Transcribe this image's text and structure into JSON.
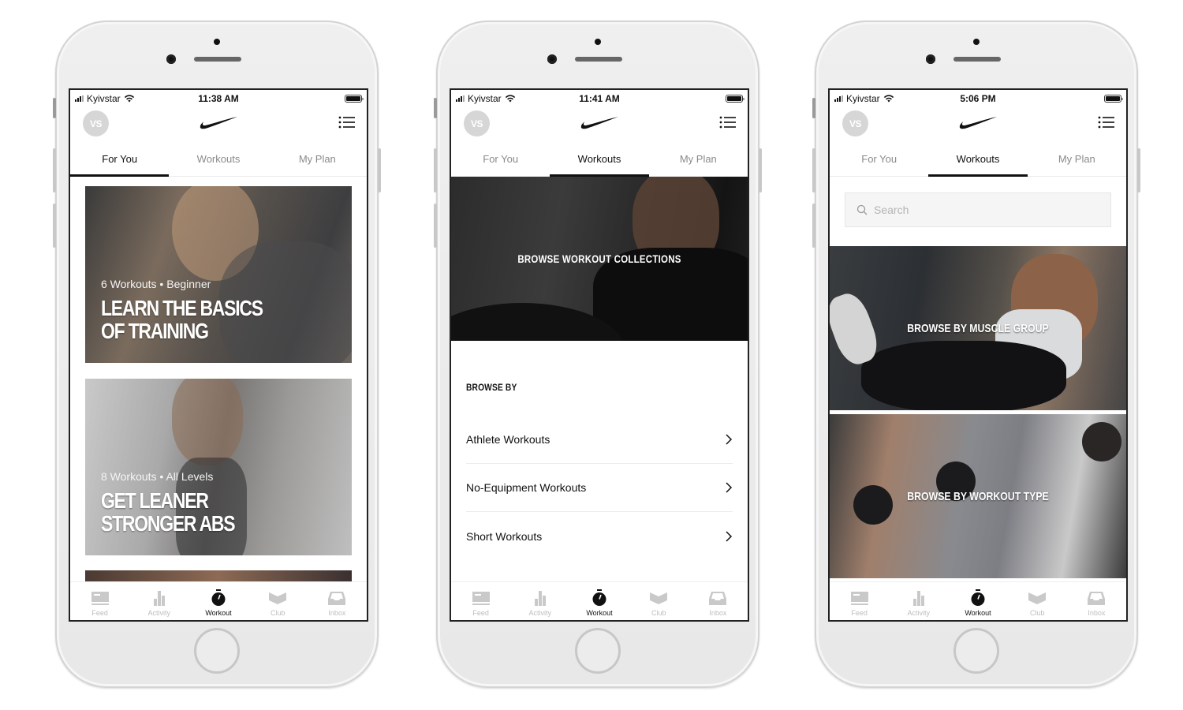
{
  "phones": [
    {
      "status": {
        "carrier": "Kyivstar",
        "time": "11:38 AM"
      },
      "header": {
        "avatar_initials": "VS",
        "logo": "nike-swoosh-icon",
        "menu_icon": "list-menu-icon"
      },
      "tabs": [
        {
          "label": "For You",
          "active": true
        },
        {
          "label": "Workouts",
          "active": false
        },
        {
          "label": "My Plan",
          "active": false
        }
      ],
      "cards": [
        {
          "meta": "6 Workouts • Beginner",
          "title_line1": "LEARN THE BASICS",
          "title_line2": "OF TRAINING"
        },
        {
          "meta": "8 Workouts • All Levels",
          "title_line1": "GET LEANER",
          "title_line2": "STRONGER ABS"
        }
      ],
      "tabbar": [
        {
          "label": "Feed",
          "icon": "feed-icon"
        },
        {
          "label": "Activity",
          "icon": "activity-icon"
        },
        {
          "label": "Workout",
          "icon": "stopwatch-icon",
          "active": true
        },
        {
          "label": "Club",
          "icon": "club-icon"
        },
        {
          "label": "Inbox",
          "icon": "inbox-icon"
        }
      ]
    },
    {
      "status": {
        "carrier": "Kyivstar",
        "time": "11:41 AM"
      },
      "header": {
        "avatar_initials": "VS",
        "logo": "nike-swoosh-icon",
        "menu_icon": "list-menu-icon"
      },
      "tabs": [
        {
          "label": "For You",
          "active": false
        },
        {
          "label": "Workouts",
          "active": true
        },
        {
          "label": "My Plan",
          "active": false
        }
      ],
      "hero": {
        "label": "BROWSE WORKOUT COLLECTIONS"
      },
      "browse_by": {
        "heading": "BROWSE BY",
        "items": [
          {
            "label": "Athlete Workouts"
          },
          {
            "label": "No-Equipment Workouts"
          },
          {
            "label": "Short Workouts"
          }
        ]
      },
      "tabbar": [
        {
          "label": "Feed",
          "icon": "feed-icon"
        },
        {
          "label": "Activity",
          "icon": "activity-icon"
        },
        {
          "label": "Workout",
          "icon": "stopwatch-icon",
          "active": true
        },
        {
          "label": "Club",
          "icon": "club-icon"
        },
        {
          "label": "Inbox",
          "icon": "inbox-icon"
        }
      ]
    },
    {
      "status": {
        "carrier": "Kyivstar",
        "time": "5:06 PM"
      },
      "header": {
        "avatar_initials": "VS",
        "logo": "nike-swoosh-icon",
        "menu_icon": "list-menu-icon"
      },
      "tabs": [
        {
          "label": "For You",
          "active": false
        },
        {
          "label": "Workouts",
          "active": true
        },
        {
          "label": "My Plan",
          "active": false
        }
      ],
      "search": {
        "placeholder": "Search",
        "value": ""
      },
      "banners": [
        {
          "label": "BROWSE BY MUSCLE GROUP"
        },
        {
          "label": "BROWSE BY WORKOUT TYPE"
        }
      ],
      "tabbar": [
        {
          "label": "Feed",
          "icon": "feed-icon"
        },
        {
          "label": "Activity",
          "icon": "activity-icon"
        },
        {
          "label": "Workout",
          "icon": "stopwatch-icon",
          "active": true
        },
        {
          "label": "Club",
          "icon": "club-icon"
        },
        {
          "label": "Inbox",
          "icon": "inbox-icon"
        }
      ]
    }
  ]
}
